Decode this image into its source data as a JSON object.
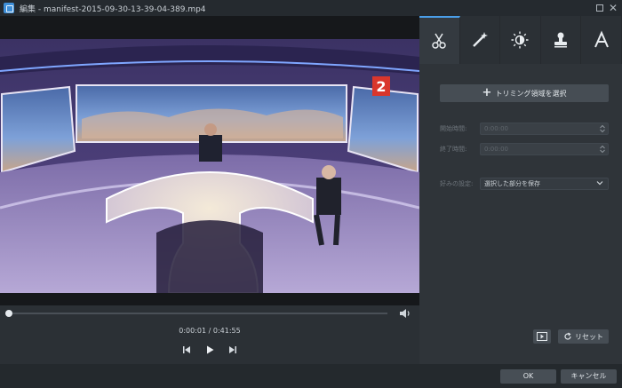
{
  "window": {
    "title": "編集 - manifest-2015-09-30-13-39-04-389.mp4",
    "maximize_icon": "maximize-icon",
    "close_icon": "close-icon"
  },
  "player": {
    "channel_logo": "2",
    "timecode": "0:00:01 / 0:41:55",
    "progress_fraction": 0.0004,
    "controls": [
      "previous-frame-icon",
      "play-icon",
      "next-frame-icon"
    ]
  },
  "tabs": [
    {
      "icon": "scissors-icon",
      "active": true
    },
    {
      "icon": "magic-wand-icon",
      "active": false
    },
    {
      "icon": "brightness-icon",
      "active": false
    },
    {
      "icon": "stamp-icon",
      "active": false
    },
    {
      "icon": "text-icon",
      "active": false
    }
  ],
  "trim": {
    "select_region_label": "トリミング領域を選択",
    "start_label": "開始時間:",
    "start_value": "0:00:00",
    "end_label": "終了時間:",
    "end_value": "0:00:00",
    "preference_label": "好みの設定:",
    "preference_value": "選択した部分を保存"
  },
  "actions": {
    "reset_label": "リセット",
    "ok_label": "OK",
    "cancel_label": "キャンセル"
  },
  "colors": {
    "accent": "#4a9ee8",
    "panel": "#2f3439",
    "background": "#2b3035"
  }
}
